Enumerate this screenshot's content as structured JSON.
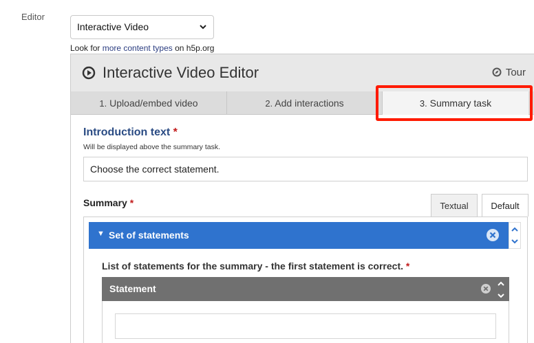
{
  "field": {
    "label": "Editor"
  },
  "library_select": {
    "value": "Interactive Video"
  },
  "look_for": {
    "prefix": "Look for ",
    "link": "more content types",
    "suffix": " on h5p.org"
  },
  "editor": {
    "title": "Interactive Video Editor",
    "tour_label": "Tour",
    "tabs": [
      {
        "num": "1.",
        "label": "Upload/embed video"
      },
      {
        "num": "2.",
        "label": "Add interactions"
      },
      {
        "num": "3.",
        "label": "Summary task"
      }
    ],
    "active_tab": 2
  },
  "intro": {
    "label": "Introduction text",
    "required_mark": "*",
    "description": "Will be displayed above the summary task.",
    "value": "Choose the correct statement."
  },
  "summary": {
    "label": "Summary",
    "required_mark": "*",
    "mode_tabs": [
      "Textual",
      "Default"
    ],
    "active_mode": "Default",
    "group_title": "Set of statements",
    "statements_label": "List of statements for the summary - the first statement is correct.",
    "statements_required_mark": "*",
    "statement_title": "Statement",
    "statement_value": ""
  },
  "colors": {
    "accent_blue": "#2f73ce",
    "highlight_red": "#ff1a00",
    "statement_bar": "#707070",
    "label_blue": "#2b4c84"
  },
  "icons": [
    "play-circle-icon",
    "compass-icon",
    "chevron-down-icon",
    "caret-down-icon",
    "close-circle-icon",
    "arrow-up-icon",
    "arrow-down-icon"
  ]
}
